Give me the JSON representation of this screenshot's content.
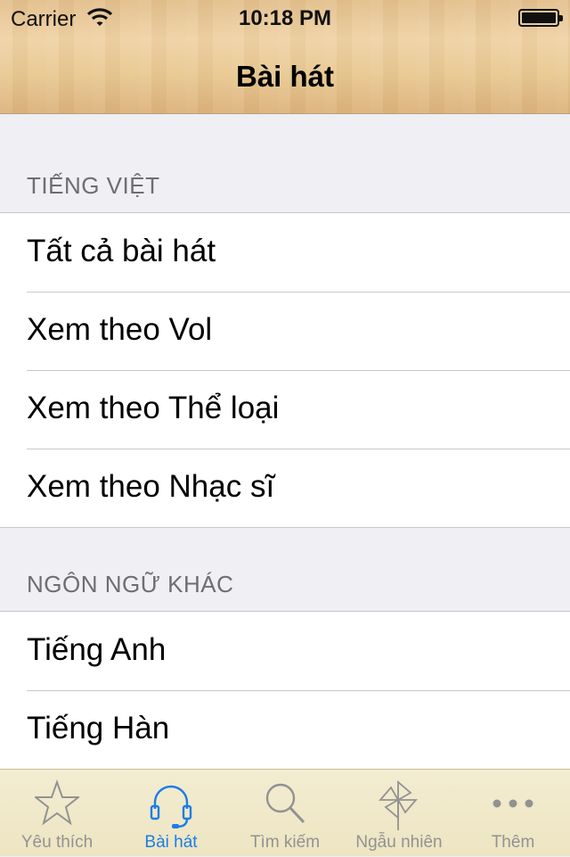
{
  "status_bar": {
    "carrier": "Carrier",
    "time": "10:18 PM"
  },
  "nav": {
    "title": "Bài hát"
  },
  "sections": [
    {
      "header": "TIẾNG VIỆT",
      "items": [
        "Tất cả bài hát",
        "Xem theo Vol",
        "Xem theo Thể loại",
        "Xem theo Nhạc sĩ"
      ]
    },
    {
      "header": "NGÔN NGỮ KHÁC",
      "items": [
        "Tiếng Anh",
        "Tiếng Hàn"
      ]
    }
  ],
  "tabbar": {
    "active_color": "#1a7ee8",
    "tabs": [
      {
        "label": "Yêu thích",
        "icon": "star-icon"
      },
      {
        "label": "Bài hát",
        "icon": "headphones-icon",
        "active": true
      },
      {
        "label": "Tìm kiếm",
        "icon": "search-icon"
      },
      {
        "label": "Ngẫu nhiên",
        "icon": "pinwheel-icon"
      },
      {
        "label": "Thêm",
        "icon": "more-icon"
      }
    ]
  }
}
